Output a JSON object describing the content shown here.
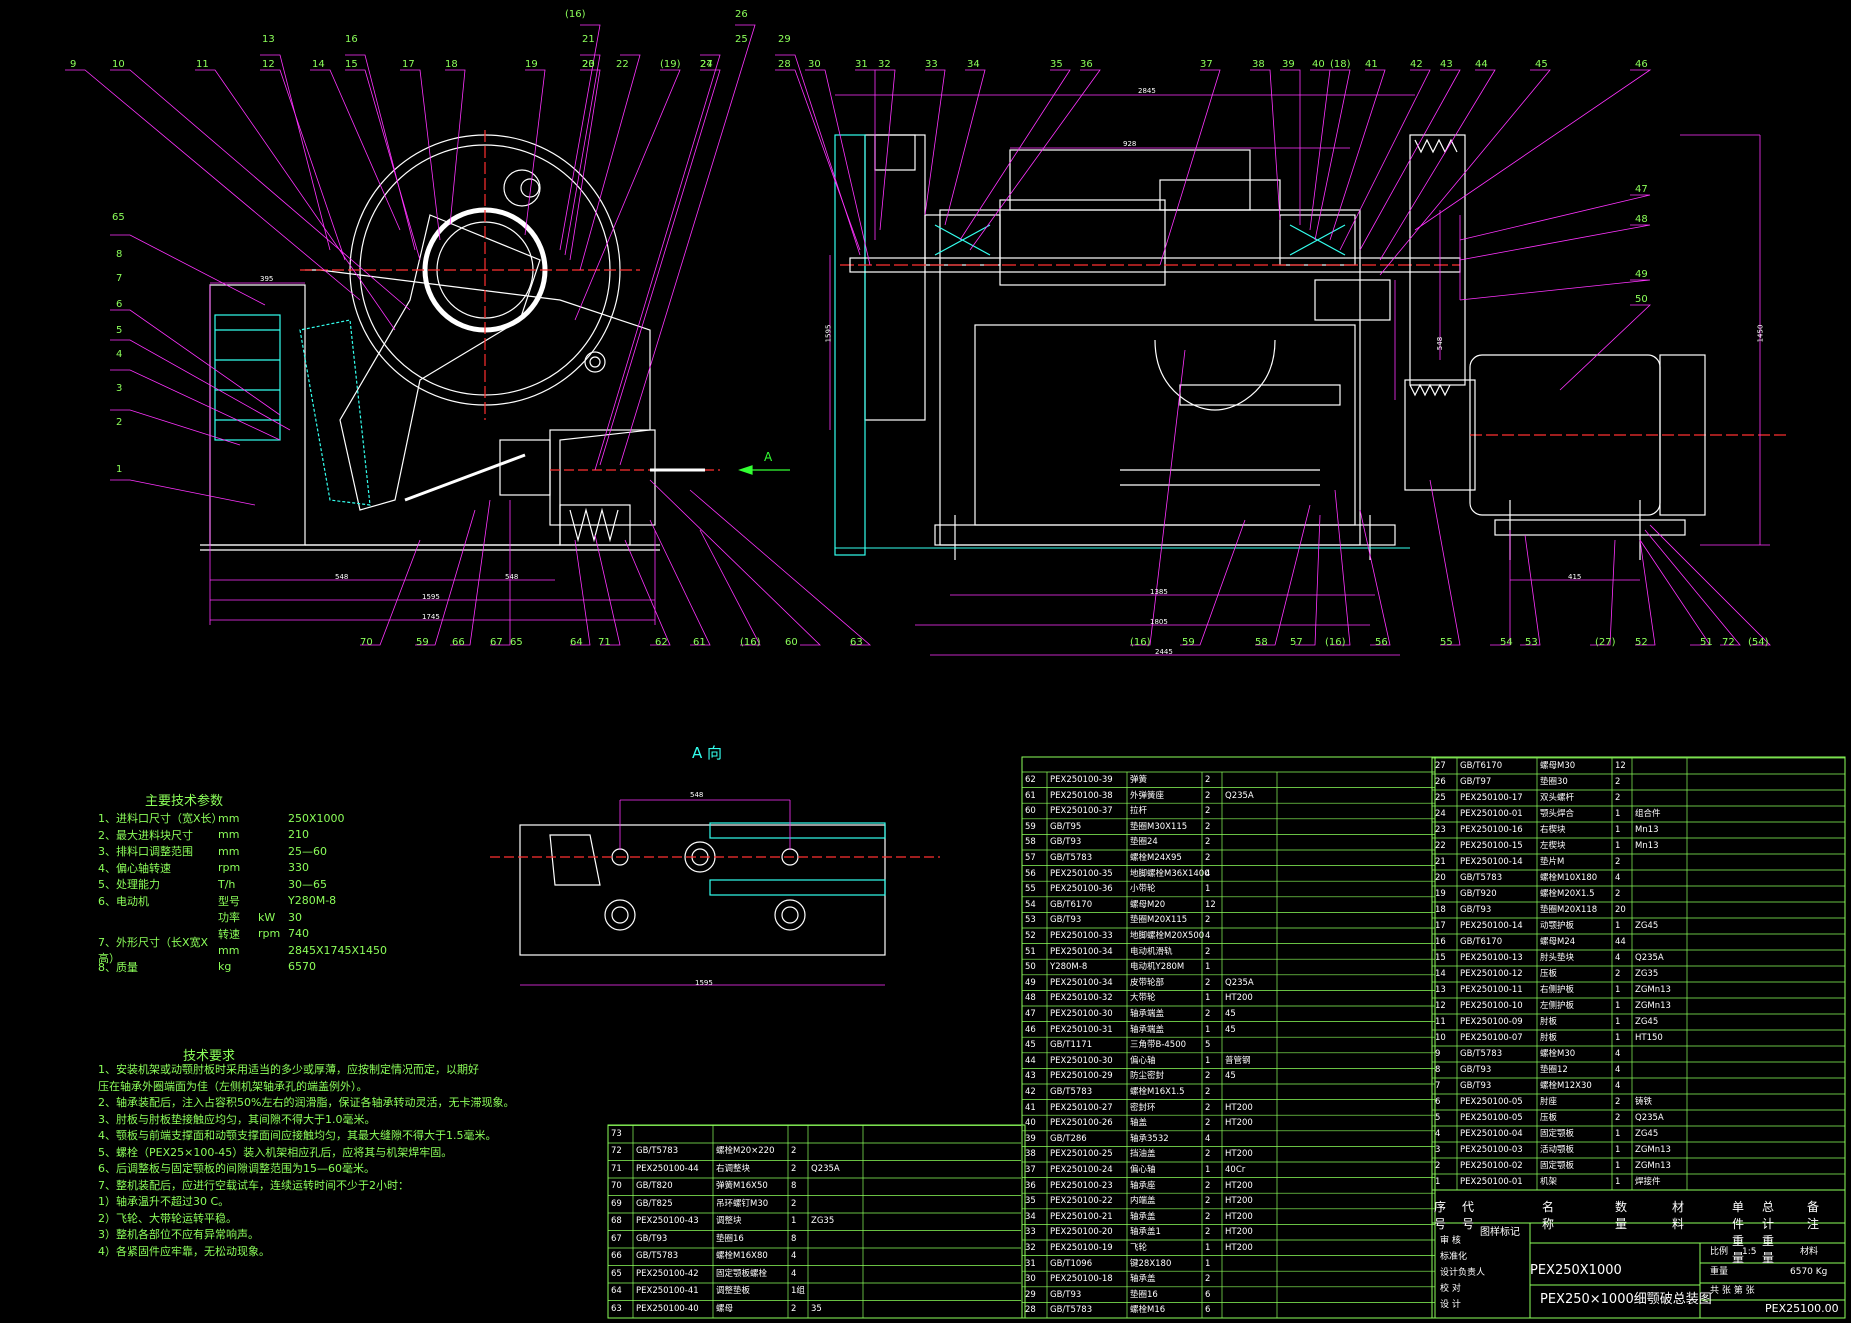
{
  "drawing": {
    "view_label": "A 向",
    "arrow_label": "A",
    "params_title": "主要技术参数",
    "requirements_title": "技术要求"
  },
  "balloons_left": [
    "9",
    "10",
    "11",
    "13",
    "12",
    "14",
    "16",
    "15",
    "17",
    "18",
    "19",
    "(16)",
    "21",
    "20",
    "23",
    "22",
    "(19)",
    "24",
    "27",
    "26",
    "25"
  ],
  "balloons_right": [
    "29",
    "28",
    "30",
    "31",
    "32",
    "33",
    "34",
    "35",
    "36",
    "37",
    "38",
    "39",
    "40",
    "(18)",
    "41",
    "42",
    "43",
    "44",
    "45",
    "46",
    "47",
    "48",
    "49",
    "50"
  ],
  "balloons_left_side": [
    "65",
    "8",
    "7",
    "6",
    "5",
    "4",
    "3",
    "2",
    "1"
  ],
  "balloons_bottom_left": [
    "70",
    "59",
    "66",
    "67",
    "65",
    "64",
    "71",
    "62",
    "61",
    "(16)",
    "60",
    "63"
  ],
  "balloons_bottom_right": [
    "(16)",
    "59",
    "58",
    "57",
    "(16)",
    "56",
    "55",
    "54",
    "53",
    "(27)",
    "52",
    "51",
    "72",
    "(54)"
  ],
  "params": [
    [
      "1、进料口尺寸（宽X长）",
      "mm",
      "250X1000",
      ""
    ],
    [
      "2、最大进料块尺寸",
      "mm",
      "210",
      ""
    ],
    [
      "3、排料口调整范围",
      "mm",
      "25—60",
      ""
    ],
    [
      "4、偏心轴转速",
      "rpm",
      "330",
      ""
    ],
    [
      "5、处理能力",
      "T/h",
      "30—65",
      ""
    ],
    [
      "6、电动机",
      "型号",
      "Y280M-8",
      ""
    ],
    [
      "",
      "功率",
      "kW",
      "30"
    ],
    [
      "",
      "转速",
      "rpm",
      "740"
    ],
    [
      "7、外形尺寸（长X宽X高）",
      "mm",
      "2845X1745X1450",
      ""
    ],
    [
      "8、质量",
      "kg",
      "6570",
      ""
    ]
  ],
  "requirements": [
    "1、安装机架或动颚肘板时采用适当的多少或厚薄，应按制定情况而定，以期好",
    "   压在轴承外圈端面为佳（左侧机架轴承孔的端盖例外）。",
    "2、轴承装配后，注入占容积50%左右的润滑脂，保证各轴承转动灵活，无卡滞现象。",
    "3、肘板与肘板垫接触应均匀，其间隙不得大于1.0毫米。",
    "4、颚板与前端支撑面和动颚支撑面间应接触均匀，其最大缝隙不得大于1.5毫米。",
    "5、螺栓（PEX25×100-45）装入机架相应孔后，应将其与机架焊牢固。",
    "6、后调整板与固定颚板的间隙调整范围为15—60毫米。",
    "7、整机装配后，应进行空载试车，连续运转时间不少于2小时：",
    "   1）轴承温升不超过30 C。",
    "   2）飞轮、大带轮运转平稳。",
    "   3）整机各部位不应有异常响声。",
    "   4）各紧固件应牢靠，无松动现象。"
  ],
  "bom_left": [
    [
      "73",
      "",
      "",
      "",
      "",
      ""
    ],
    [
      "72",
      "GB/T5783",
      "螺栓M20×220",
      "2",
      "",
      ""
    ],
    [
      "71",
      "PEX250100-44",
      "右调整块",
      "2",
      "Q235A",
      ""
    ],
    [
      "70",
      "GB/T820",
      "弹簧M16X50",
      "8",
      "",
      ""
    ],
    [
      "69",
      "GB/T825",
      "吊环螺钉M30",
      "2",
      "",
      ""
    ],
    [
      "68",
      "PEX250100-43",
      "调整块",
      "1",
      "ZG35",
      ""
    ],
    [
      "67",
      "GB/T93",
      "垫圈16",
      "8",
      "",
      ""
    ],
    [
      "66",
      "GB/T5783",
      "螺栓M16X80",
      "4",
      "",
      ""
    ],
    [
      "65",
      "PEX250100-42",
      "固定颚板螺栓",
      "4",
      "",
      ""
    ],
    [
      "64",
      "PEX250100-41",
      "调整垫板",
      "1组",
      "",
      ""
    ],
    [
      "63",
      "PEX250100-40",
      "螺母",
      "2",
      "35",
      ""
    ]
  ],
  "bom_mid": [
    [
      "62",
      "PEX250100-39",
      "弹簧",
      "2",
      ""
    ],
    [
      "61",
      "PEX250100-38",
      "外弹簧座",
      "2",
      "Q235A"
    ],
    [
      "60",
      "PEX250100-37",
      "拉杆",
      "2",
      ""
    ],
    [
      "59",
      "GB/T95",
      "垫圈M30X115",
      "2",
      ""
    ],
    [
      "58",
      "GB/T93",
      "垫圈24",
      "2",
      ""
    ],
    [
      "57",
      "GB/T5783",
      "螺栓M24X95",
      "2",
      ""
    ],
    [
      "56",
      "PEX250100-35",
      "地脚螺栓M36X1400",
      "4",
      ""
    ],
    [
      "55",
      "PEX250100-36",
      "小带轮",
      "1",
      ""
    ],
    [
      "54",
      "GB/T6170",
      "螺母M20",
      "12",
      ""
    ],
    [
      "53",
      "GB/T93",
      "垫圈M20X115",
      "2",
      ""
    ],
    [
      "52",
      "PEX250100-33",
      "地脚螺栓M20X500",
      "4",
      ""
    ],
    [
      "51",
      "PEX250100-34",
      "电动机滑轨",
      "2",
      ""
    ],
    [
      "50",
      "Y280M-8",
      "电动机Y280M",
      "1",
      ""
    ],
    [
      "49",
      "PEX250100-34",
      "皮带轮部",
      "2",
      "Q235A"
    ],
    [
      "48",
      "PEX250100-32",
      "大带轮",
      "1",
      "HT200"
    ],
    [
      "47",
      "PEX250100-30",
      "轴承端盖",
      "2",
      "45"
    ],
    [
      "46",
      "PEX250100-31",
      "轴承端盖",
      "1",
      "45"
    ],
    [
      "45",
      "GB/T1171",
      "三角带B-4500",
      "5",
      ""
    ],
    [
      "44",
      "PEX250100-30",
      "偏心轴",
      "1",
      "普管钢"
    ],
    [
      "43",
      "PEX250100-29",
      "防尘密封",
      "2",
      "45"
    ],
    [
      "42",
      "GB/T5783",
      "螺栓M16X1.5",
      "2",
      ""
    ],
    [
      "41",
      "PEX250100-27",
      "密封环",
      "2",
      "HT200"
    ],
    [
      "40",
      "PEX250100-26",
      "轴盖",
      "2",
      "HT200"
    ],
    [
      "39",
      "GB/T286",
      "轴承3532",
      "4",
      ""
    ],
    [
      "38",
      "PEX250100-25",
      "挡油盖",
      "2",
      "HT200"
    ],
    [
      "37",
      "PEX250100-24",
      "偏心轴",
      "1",
      "40Cr"
    ],
    [
      "36",
      "PEX250100-23",
      "轴承座",
      "2",
      "HT200"
    ],
    [
      "35",
      "PEX250100-22",
      "内端盖",
      "2",
      "HT200"
    ],
    [
      "34",
      "PEX250100-21",
      "轴承盖",
      "2",
      "HT200"
    ],
    [
      "33",
      "PEX250100-20",
      "轴承盖1",
      "2",
      "HT200"
    ],
    [
      "32",
      "PEX250100-19",
      "飞轮",
      "1",
      "HT200"
    ],
    [
      "31",
      "GB/T1096",
      "键28X180",
      "1",
      ""
    ],
    [
      "30",
      "PEX250100-18",
      "轴承盖",
      "2",
      ""
    ],
    [
      "29",
      "GB/T93",
      "垫圈16",
      "6",
      ""
    ],
    [
      "28",
      "GB/T5783",
      "螺栓M16",
      "6",
      ""
    ]
  ],
  "bom_right": [
    [
      "27",
      "GB/T6170",
      "螺母M30",
      "12",
      ""
    ],
    [
      "26",
      "GB/T97",
      "垫圈30",
      "2",
      ""
    ],
    [
      "25",
      "PEX250100-17",
      "双头螺杆",
      "2",
      ""
    ],
    [
      "24",
      "PEX250100-01",
      "颚头焊合",
      "1",
      "组合件"
    ],
    [
      "23",
      "PEX250100-16",
      "右楔块",
      "1",
      "Mn13"
    ],
    [
      "22",
      "PEX250100-15",
      "左楔块",
      "1",
      "Mn13"
    ],
    [
      "21",
      "PEX250100-14",
      "垫片M",
      "2",
      ""
    ],
    [
      "20",
      "GB/T5783",
      "螺栓M10X180",
      "4",
      ""
    ],
    [
      "19",
      "GB/T920",
      "螺栓M20X1.5",
      "2",
      ""
    ],
    [
      "18",
      "GB/T93",
      "垫圈M20X118",
      "20",
      ""
    ],
    [
      "17",
      "PEX250100-14",
      "动颚护板",
      "1",
      "ZG45"
    ],
    [
      "16",
      "GB/T6170",
      "螺母M24",
      "44",
      ""
    ],
    [
      "15",
      "PEX250100-13",
      "肘头垫块",
      "4",
      "Q235A"
    ],
    [
      "14",
      "PEX250100-12",
      "压板",
      "2",
      "ZG35"
    ],
    [
      "13",
      "PEX250100-11",
      "右侧护板",
      "1",
      "ZGMn13"
    ],
    [
      "12",
      "PEX250100-10",
      "左侧护板",
      "1",
      "ZGMn13"
    ],
    [
      "11",
      "PEX250100-09",
      "肘板",
      "1",
      "ZG45"
    ],
    [
      "10",
      "PEX250100-07",
      "肘板",
      "1",
      "HT150"
    ],
    [
      "9",
      "GB/T5783",
      "螺栓M30",
      "4",
      ""
    ],
    [
      "8",
      "GB/T93",
      "垫圈12",
      "4",
      ""
    ],
    [
      "7",
      "GB/T93",
      "螺栓M12X30",
      "4",
      ""
    ],
    [
      "6",
      "PEX250100-05",
      "肘座",
      "2",
      "铸铁"
    ],
    [
      "5",
      "PEX250100-05",
      "压板",
      "2",
      "Q235A"
    ],
    [
      "4",
      "PEX250100-04",
      "固定颚板",
      "1",
      "ZG45"
    ],
    [
      "3",
      "PEX250100-03",
      "活动颚板",
      "1",
      "ZGMn13"
    ],
    [
      "2",
      "PEX250100-02",
      "固定颚板",
      "1",
      "ZGMn13"
    ],
    [
      "1",
      "PEX250100-01",
      "机架",
      "1",
      "焊接件"
    ]
  ],
  "bom_header": [
    "序号",
    "代 号",
    "名 称",
    "数量",
    "材 料",
    "单件重量",
    "总计重量",
    "备 注"
  ],
  "title_block": {
    "model": "PEX250X1000",
    "title": "PEX250×1000细颚破总装图",
    "drawing_no": "PEX25100.00",
    "mark": "图样标记",
    "roles": [
      "审 核",
      "标准化",
      "设计负责人",
      "校 对",
      "设 计"
    ],
    "scale_label": "比例",
    "scale": "1:5",
    "weight_label": "重量",
    "weight": "6570 Kg",
    "sheet": "共 张 第 张",
    "material_label": "材料"
  },
  "dims": {
    "d395": "395",
    "d548a": "548",
    "d548b": "548",
    "d1595": "1595",
    "d1745": "1745",
    "d2845": "2845",
    "d928": "928",
    "d1385": "1385",
    "d1805": "1805",
    "d2445": "2445",
    "d415": "415",
    "d1450": "1450",
    "d548c": "548",
    "d1595b": "1595",
    "a_w": "548",
    "a_w2": "1595"
  },
  "colors": {
    "background": "#000000",
    "outline": "#ffffff",
    "leader": "#ff33ff",
    "table": "#8cff5a",
    "hatch": "#33ffee",
    "center": "#ff3030",
    "dim": "#ff33ff"
  }
}
